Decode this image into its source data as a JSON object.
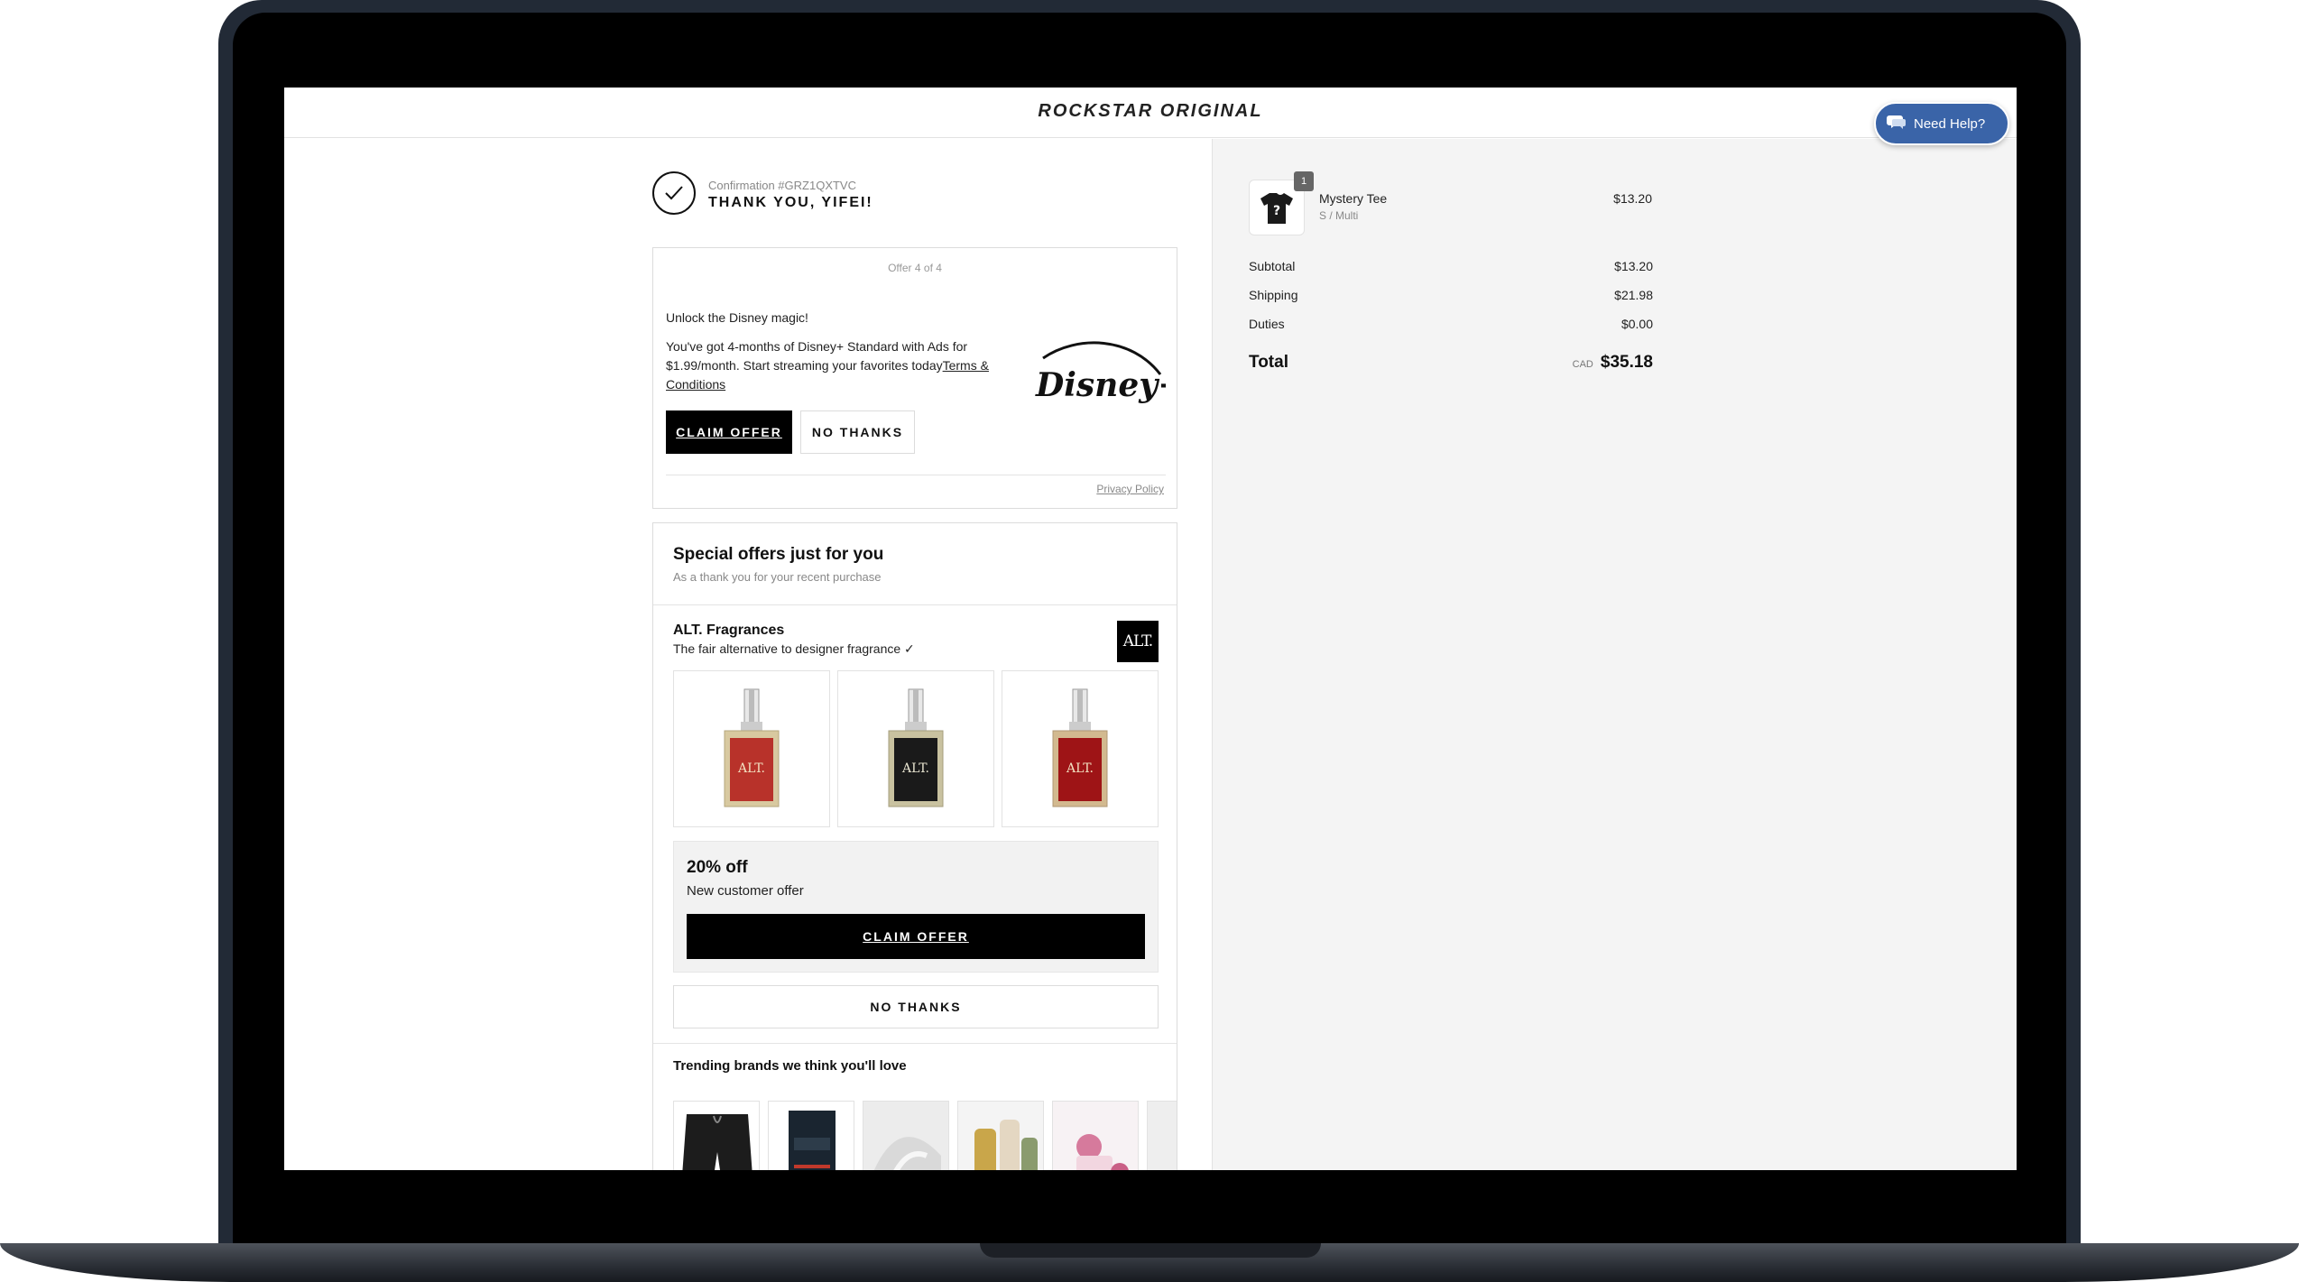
{
  "header": {
    "brand": "ROCKSTAR ORIGINAL",
    "help_label": "Need Help?"
  },
  "confirmation": {
    "number": "Confirmation #GRZ1QXTVC",
    "thank_you": "THANK YOU, YIFEI!"
  },
  "offer": {
    "counter": "Offer 4 of 4",
    "headline": "Unlock the Disney magic!",
    "body": "You've got 4-months of Disney+ Standard with Ads for $1.99/month. Start streaming your favorites today",
    "terms_link": "Terms & Conditions",
    "claim_label": "CLAIM OFFER",
    "decline_label": "NO THANKS",
    "privacy_label": "Privacy Policy",
    "partner_logo_text": "Disney+"
  },
  "special_offers": {
    "title": "Special offers just for you",
    "subtitle": "As a thank you for your recent purchase",
    "brand": {
      "name": "ALT. Fragrances",
      "tagline": "The fair alternative to designer fragrance ✓",
      "logo_text": "ALT.",
      "products": [
        {
          "label": "ALT.",
          "bottle_color": "#b8322a"
        },
        {
          "label": "ALT.",
          "bottle_color": "#1a1a1a"
        },
        {
          "label": "ALT.",
          "bottle_color": "#9e1416"
        }
      ],
      "discount_title": "20% off",
      "discount_subtitle": "New customer offer",
      "claim_label": "CLAIM OFFER",
      "decline_label": "NO THANKS"
    },
    "trending_title": "Trending brands we think you'll love"
  },
  "order_summary": {
    "item": {
      "quantity": "1",
      "name": "Mystery Tee",
      "variant": "S / Multi",
      "price": "$13.20"
    },
    "subtotal_label": "Subtotal",
    "subtotal_value": "$13.20",
    "shipping_label": "Shipping",
    "shipping_value": "$21.98",
    "duties_label": "Duties",
    "duties_value": "$0.00",
    "total_label": "Total",
    "total_currency": "CAD",
    "total_value": "$35.18"
  },
  "colors": {
    "help_button": "#3a64a8",
    "primary_button": "#000000",
    "summary_background": "#f4f4f4"
  }
}
